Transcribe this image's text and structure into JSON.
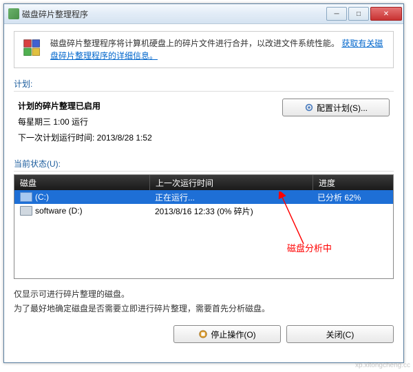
{
  "window": {
    "title": "磁盘碎片整理程序"
  },
  "banner": {
    "text": "磁盘碎片整理程序将计算机硬盘上的碎片文件进行合并，以改进文件系统性能。",
    "link": "获取有关磁盘碎片整理程序的详细信息。"
  },
  "schedule": {
    "section_label": "计划:",
    "title": "计划的碎片整理已启用",
    "line1": "每星期三 1:00 运行",
    "line2": "下一次计划运行时间: 2013/8/28 1:52",
    "config_button": "配置计划(S)..."
  },
  "status": {
    "section_label": "当前状态(U):",
    "columns": {
      "disk": "磁盘",
      "last_run": "上一次运行时间",
      "progress": "进度"
    },
    "rows": [
      {
        "name": "(C:)",
        "last_run": "正在运行...",
        "progress": "已分析 62%",
        "selected": true
      },
      {
        "name": "software (D:)",
        "last_run": "2013/8/16 12:33 (0% 碎片)",
        "progress": "",
        "selected": false
      }
    ]
  },
  "footer": {
    "note1": "仅显示可进行碎片整理的磁盘。",
    "note2": "为了最好地确定磁盘是否需要立即进行碎片整理，需要首先分析磁盘。",
    "stop_button": "停止操作(O)",
    "close_button": "关闭(C)"
  },
  "annotation": {
    "label": "磁盘分析中"
  },
  "watermark": "xp.xitongcheng.cc"
}
